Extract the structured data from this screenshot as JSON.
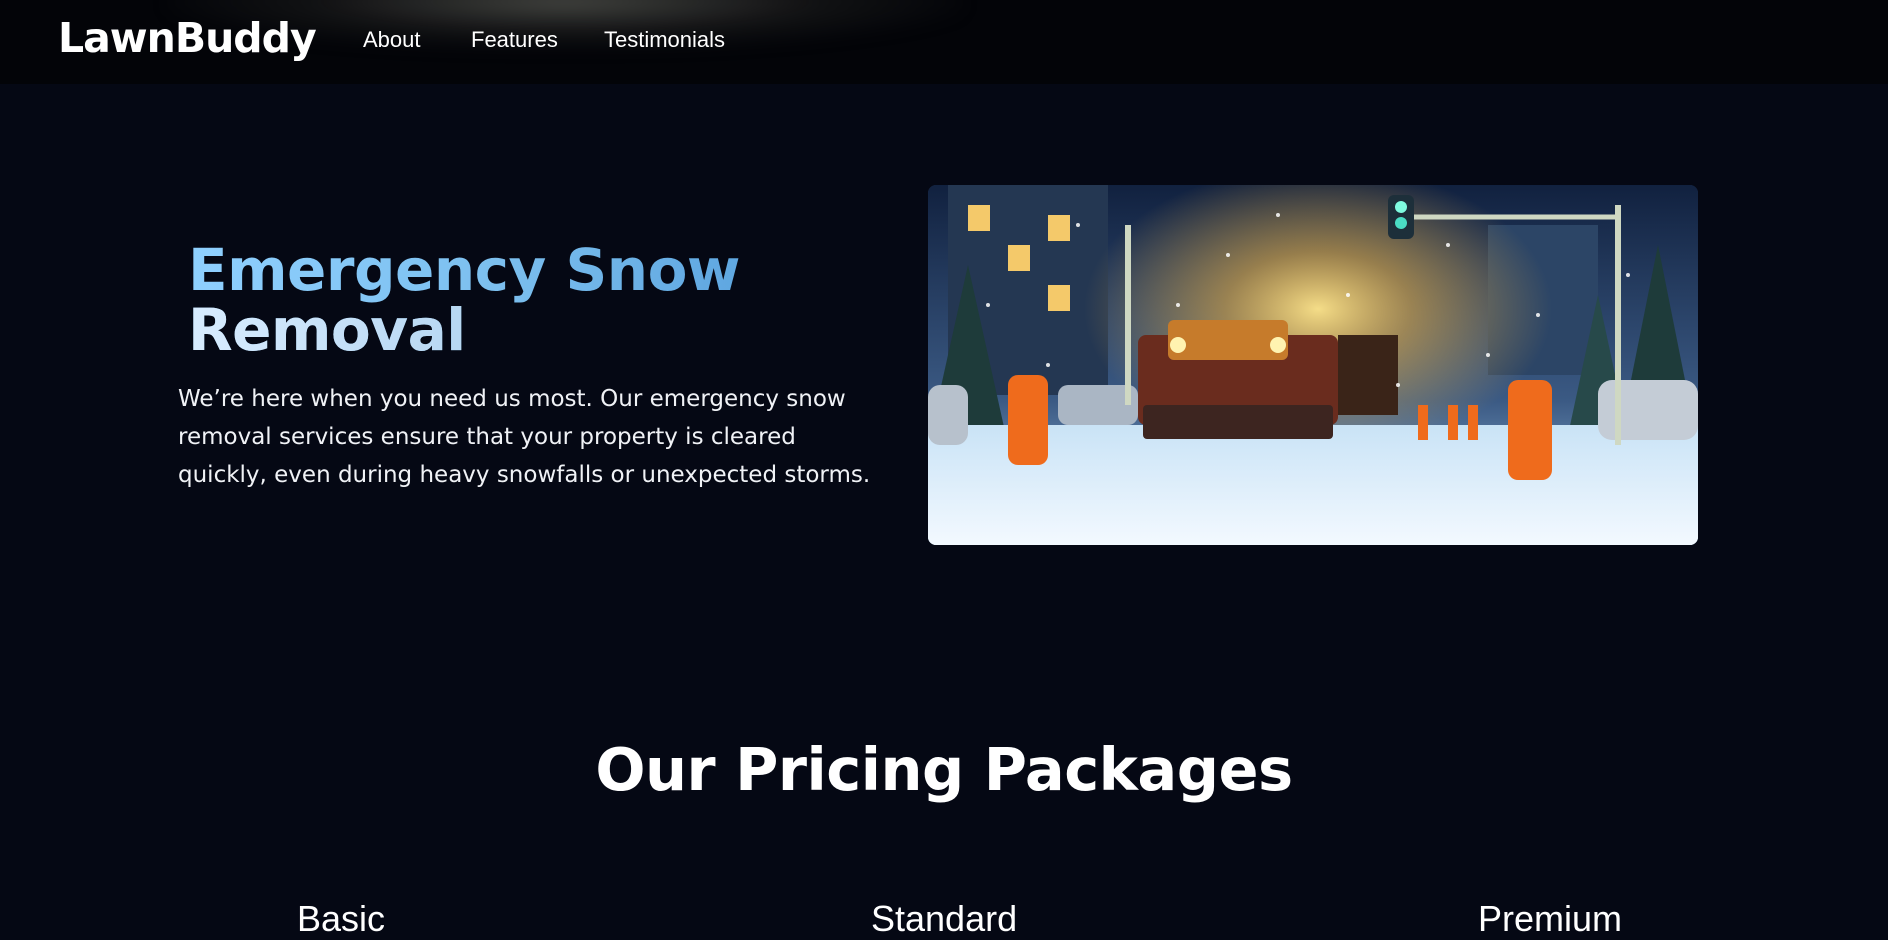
{
  "nav": {
    "brand": "LawnBuddy",
    "links": [
      {
        "label": "About"
      },
      {
        "label": "Features"
      },
      {
        "label": "Testimonials"
      }
    ]
  },
  "hero": {
    "title_line1": "Emergency Snow",
    "title_line2": "Removal",
    "description": "We’re here when you need us most. Our emergency snow removal services ensure that your property is cleared quickly, even during heavy snowfalls or unexpected storms.",
    "image_alt": "Snow plow truck and workers clearing snow at night"
  },
  "pricing": {
    "title": "Our Pricing Packages",
    "plans": [
      {
        "name": "Basic"
      },
      {
        "name": "Standard"
      },
      {
        "name": "Premium"
      }
    ]
  }
}
